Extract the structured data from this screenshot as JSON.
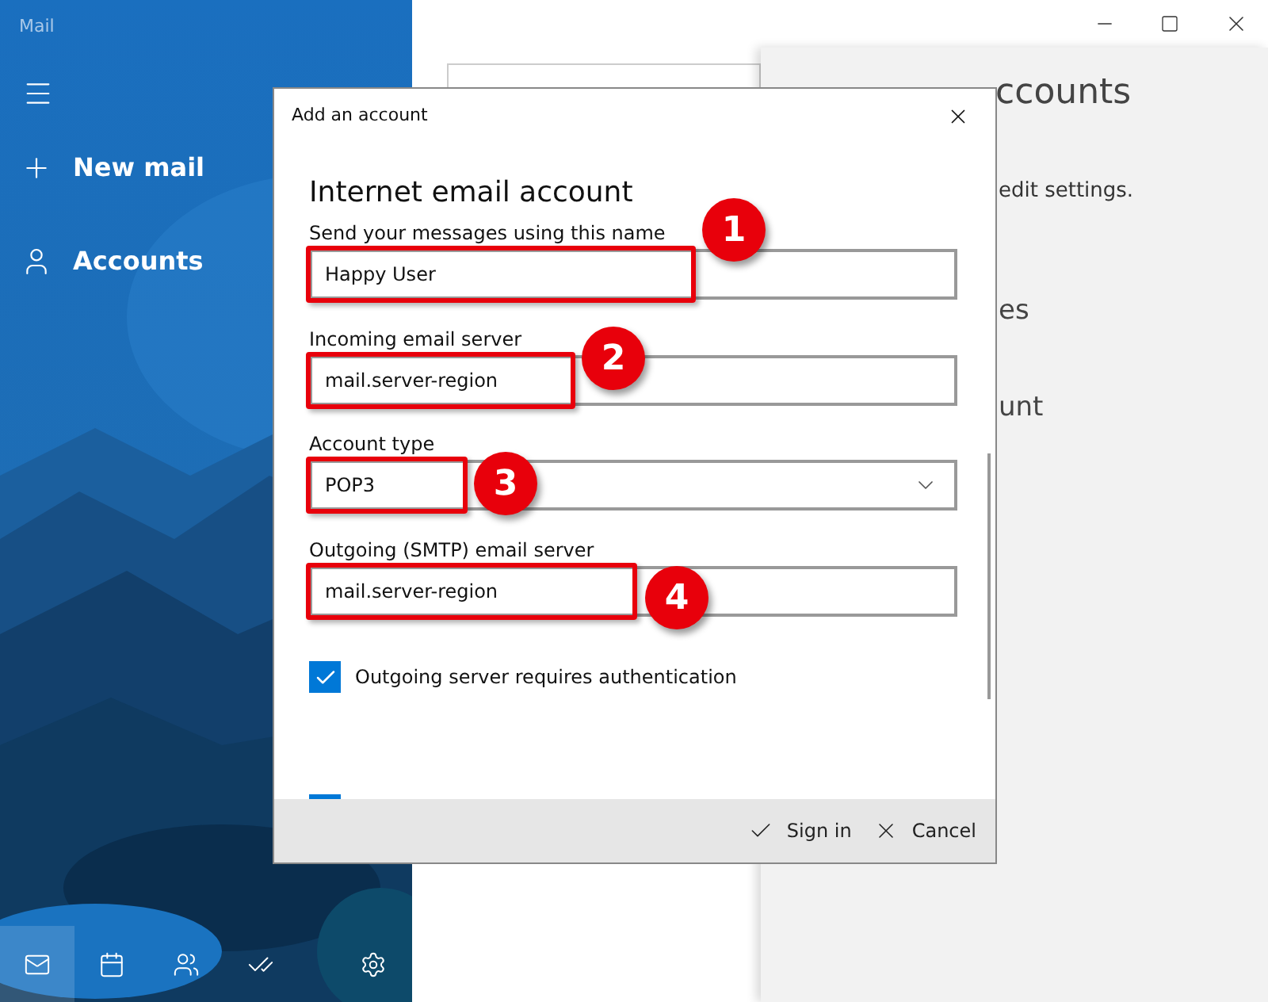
{
  "app": {
    "title": "Mail"
  },
  "sidebar": {
    "items": [
      {
        "kind": "new",
        "label": "New mail"
      },
      {
        "kind": "accounts",
        "label": "Accounts"
      }
    ]
  },
  "bottom_nav": [
    {
      "kind": "mail",
      "selected": true
    },
    {
      "kind": "calendar",
      "selected": false
    },
    {
      "kind": "people",
      "selected": false
    },
    {
      "kind": "todo",
      "selected": false
    },
    {
      "kind": "settings",
      "selected": false
    }
  ],
  "manage_panel": {
    "title": "ccounts",
    "fragments": [
      "edit settings.",
      "es",
      "unt"
    ]
  },
  "dialog": {
    "title": "Add an account",
    "heading": "Internet email account",
    "fields": [
      {
        "kind": "text",
        "label": "Send your messages using this name",
        "value": "Happy User",
        "highlighted": true
      },
      {
        "kind": "text",
        "label": "Incoming email server",
        "value": "mail.server-region",
        "highlighted": true
      },
      {
        "kind": "select",
        "label": "Account type",
        "value": "POP3",
        "highlighted": true
      },
      {
        "kind": "text",
        "label": "Outgoing (SMTP) email server",
        "value": "mail.server-region",
        "highlighted": true
      }
    ],
    "checkboxes": [
      {
        "label": "Outgoing server requires authentication",
        "checked": true
      },
      {
        "checked": true
      }
    ],
    "buttons": [
      {
        "kind": "confirm",
        "label": "Sign in"
      },
      {
        "kind": "cancel",
        "label": "Cancel"
      }
    ]
  },
  "annotations": [
    "1",
    "2",
    "3",
    "4"
  ]
}
